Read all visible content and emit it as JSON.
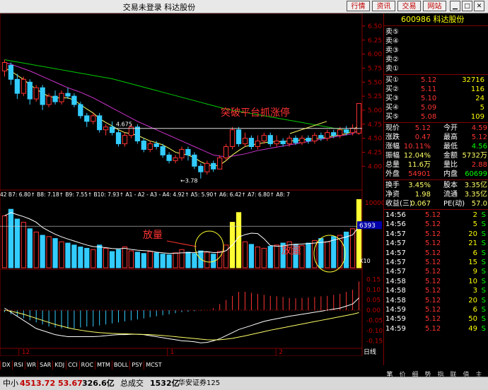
{
  "window": {
    "title": "交易未登录  科达股份"
  },
  "toolbar_buttons": [
    "行情",
    "资讯",
    "交易",
    "网站"
  ],
  "stock": {
    "code": "600986",
    "name": "科达股份"
  },
  "order_book": {
    "asks": [
      {
        "label": "卖⑤"
      },
      {
        "label": "卖④"
      },
      {
        "label": "卖③"
      },
      {
        "label": "卖②"
      },
      {
        "label": "卖①"
      }
    ],
    "bids": [
      {
        "label": "买①",
        "price": "5.12",
        "vol": "32716"
      },
      {
        "label": "买②",
        "price": "5.11",
        "vol": "116"
      },
      {
        "label": "买③",
        "price": "5.10",
        "vol": "24"
      },
      {
        "label": "买④",
        "price": "5.09",
        "vol": "5"
      },
      {
        "label": "买⑤",
        "price": "5.08",
        "vol": "109"
      }
    ]
  },
  "quote": [
    {
      "l1": "现价",
      "v1": "5.12",
      "l2": "今开",
      "v2": "4.59"
    },
    {
      "l1": "涨跌",
      "v1": "0.47",
      "l2": "最高",
      "v2": "5.12"
    },
    {
      "l1": "涨幅",
      "v1": "10.11%",
      "l2": "最低",
      "v2": "4.56"
    },
    {
      "l1": "振幅",
      "v1": "12.04%",
      "l2": "金额",
      "v2": "5732万"
    },
    {
      "l1": "总量",
      "v1": "11.6万",
      "l2": "量比",
      "v2": "2.88"
    },
    {
      "l1": "外盘",
      "v1": "54901",
      "l2": "内盘",
      "v2": "60699"
    },
    {
      "l1": "换手",
      "v1": "3.45%",
      "l2": "股本",
      "v2": "3.35亿"
    },
    {
      "l1": "净资",
      "v1": "1.98",
      "l2": "流通",
      "v2": "3.35亿"
    },
    {
      "l1": "收益(三)",
      "v1": "0.067",
      "l2": "PE(动)",
      "v2": "57.0"
    }
  ],
  "ticks": [
    {
      "t": "14:56",
      "p": "5.12",
      "v": "2",
      "s": "S"
    },
    {
      "t": "14:56",
      "p": "5.12",
      "v": "5",
      "s": "S"
    },
    {
      "t": "14:57",
      "p": "5.12",
      "v": "20",
      "s": "S"
    },
    {
      "t": "14:57",
      "p": "5.12",
      "v": "21",
      "s": "S"
    },
    {
      "t": "14:57",
      "p": "5.12",
      "v": "6",
      "s": "S"
    },
    {
      "t": "14:57",
      "p": "5.12",
      "v": "15",
      "s": "S"
    },
    {
      "t": "14:57",
      "p": "5.12",
      "v": "9",
      "s": "S"
    },
    {
      "t": "14:58",
      "p": "5.12",
      "v": "10",
      "s": "S"
    },
    {
      "t": "14:58",
      "p": "5.12",
      "v": "3",
      "s": "S"
    },
    {
      "t": "14:58",
      "p": "5.12",
      "v": "20",
      "s": "S"
    },
    {
      "t": "14:59",
      "p": "5.12",
      "v": "6",
      "s": "S"
    },
    {
      "t": "14:59",
      "p": "5.12",
      "v": "50",
      "s": "S"
    },
    {
      "t": "14:59",
      "p": "5.12",
      "v": "49",
      "s": "S"
    }
  ],
  "price_axis": [
    "6.50",
    "6.25",
    "6.00",
    "5.75",
    "5.50",
    "5.25",
    "5.00",
    "4.75",
    "4.50",
    "4.25",
    "4.00"
  ],
  "volume_axis": [
    "10000",
    "6393",
    "X10"
  ],
  "macd_axis": [
    "0.15",
    "0.10",
    "0.05",
    "0.00",
    "-0.05",
    "-0.10",
    "-0.15"
  ],
  "annotations": {
    "breakout": "突破平台抓涨停",
    "volume1": "放量",
    "volume2": "放量",
    "level_label": "4.675",
    "low_label": "3.78"
  },
  "ma_legend": "42  B7: 6.80↑  B8: 7.18↑  B9: 7.55↑  B10: 7.93↑  A1 - A2 - A3 - A4: 4.92↑  A5: 5.90↑  A6: 6.42↑  A7: 6.80↑  A8: 7",
  "date_axis": [
    "12",
    "1",
    "2"
  ],
  "period_label": "日线",
  "indicator_tabs": [
    "DX",
    "RSI",
    "WR",
    "SAR",
    "KDJ",
    "CCI",
    "ROC",
    "MTM",
    "BOLL",
    "PSY",
    "MCST"
  ],
  "right_tabs": [
    "笔",
    "价",
    "细",
    "势",
    "指",
    "联",
    "值",
    "主"
  ],
  "status": {
    "index_name": "中小",
    "index_value": "4513.72",
    "index_change": "53.67",
    "index_amount": "326.6亿",
    "total_label": "总成交",
    "total_value": "1532亿",
    "broker": "华安证券125"
  },
  "chart_data": {
    "type": "candlestick",
    "price_ylim": [
      3.6,
      6.6
    ],
    "candles": [
      {
        "o": 5.7,
        "c": 5.85,
        "h": 5.9,
        "l": 5.6
      },
      {
        "o": 5.8,
        "c": 5.55,
        "h": 5.85,
        "l": 5.45
      },
      {
        "o": 5.55,
        "c": 5.3,
        "h": 5.65,
        "l": 5.2
      },
      {
        "o": 5.3,
        "c": 5.55,
        "h": 5.6,
        "l": 5.25
      },
      {
        "o": 5.5,
        "c": 5.2,
        "h": 5.55,
        "l": 5.1
      },
      {
        "o": 5.2,
        "c": 5.4,
        "h": 5.45,
        "l": 5.15
      },
      {
        "o": 5.4,
        "c": 5.1,
        "h": 5.45,
        "l": 5.0
      },
      {
        "o": 5.1,
        "c": 5.25,
        "h": 5.3,
        "l": 5.05
      },
      {
        "o": 5.25,
        "c": 5.15,
        "h": 5.35,
        "l": 5.1
      },
      {
        "o": 5.15,
        "c": 5.3,
        "h": 5.35,
        "l": 5.1
      },
      {
        "o": 5.3,
        "c": 5.25,
        "h": 5.4,
        "l": 5.2
      },
      {
        "o": 5.25,
        "c": 5.1,
        "h": 5.3,
        "l": 5.05
      },
      {
        "o": 5.1,
        "c": 4.9,
        "h": 5.15,
        "l": 4.85
      },
      {
        "o": 4.9,
        "c": 4.8,
        "h": 4.95,
        "l": 4.7
      },
      {
        "o": 4.8,
        "c": 4.9,
        "h": 4.95,
        "l": 4.75
      },
      {
        "o": 4.9,
        "c": 4.65,
        "h": 4.95,
        "l": 4.6
      },
      {
        "o": 4.65,
        "c": 4.7,
        "h": 4.75,
        "l": 4.55
      },
      {
        "o": 4.7,
        "c": 4.6,
        "h": 4.8,
        "l": 4.55
      },
      {
        "o": 4.6,
        "c": 4.4,
        "h": 4.65,
        "l": 4.35
      },
      {
        "o": 4.4,
        "c": 4.55,
        "h": 4.6,
        "l": 4.35
      },
      {
        "o": 4.55,
        "c": 4.7,
        "h": 4.75,
        "l": 4.5
      },
      {
        "o": 4.7,
        "c": 4.45,
        "h": 4.75,
        "l": 4.4
      },
      {
        "o": 4.45,
        "c": 4.3,
        "h": 4.5,
        "l": 4.25
      },
      {
        "o": 4.3,
        "c": 4.4,
        "h": 4.45,
        "l": 4.25
      },
      {
        "o": 4.4,
        "c": 4.35,
        "h": 4.45,
        "l": 4.3
      },
      {
        "o": 4.35,
        "c": 4.2,
        "h": 4.4,
        "l": 4.15
      },
      {
        "o": 4.2,
        "c": 4.1,
        "h": 4.25,
        "l": 4.05
      },
      {
        "o": 4.1,
        "c": 4.15,
        "h": 4.2,
        "l": 4.05
      },
      {
        "o": 4.15,
        "c": 4.3,
        "h": 4.35,
        "l": 4.1
      },
      {
        "o": 4.3,
        "c": 4.2,
        "h": 4.35,
        "l": 4.1
      },
      {
        "o": 4.2,
        "c": 4.0,
        "h": 4.25,
        "l": 3.95
      },
      {
        "o": 4.0,
        "c": 3.9,
        "h": 4.05,
        "l": 3.78
      },
      {
        "o": 3.9,
        "c": 4.05,
        "h": 4.1,
        "l": 3.85
      },
      {
        "o": 4.05,
        "c": 3.95,
        "h": 4.1,
        "l": 3.9
      },
      {
        "o": 3.95,
        "c": 4.15,
        "h": 4.2,
        "l": 3.95
      },
      {
        "o": 4.15,
        "c": 4.35,
        "h": 4.4,
        "l": 4.1
      },
      {
        "o": 4.35,
        "c": 4.65,
        "h": 4.7,
        "l": 4.3
      },
      {
        "o": 4.65,
        "c": 4.4,
        "h": 4.7,
        "l": 4.35
      },
      {
        "o": 4.4,
        "c": 4.5,
        "h": 4.6,
        "l": 4.35
      },
      {
        "o": 4.5,
        "c": 4.35,
        "h": 4.55,
        "l": 4.3
      },
      {
        "o": 4.35,
        "c": 4.45,
        "h": 4.55,
        "l": 4.3
      },
      {
        "o": 4.45,
        "c": 4.55,
        "h": 4.6,
        "l": 4.4
      },
      {
        "o": 4.55,
        "c": 4.4,
        "h": 4.6,
        "l": 4.35
      },
      {
        "o": 4.4,
        "c": 4.45,
        "h": 4.55,
        "l": 4.35
      },
      {
        "o": 4.45,
        "c": 4.4,
        "h": 4.5,
        "l": 4.35
      },
      {
        "o": 4.4,
        "c": 4.5,
        "h": 4.55,
        "l": 4.35
      },
      {
        "o": 4.5,
        "c": 4.42,
        "h": 4.55,
        "l": 4.38
      },
      {
        "o": 4.42,
        "c": 4.5,
        "h": 4.55,
        "l": 4.38
      },
      {
        "o": 4.5,
        "c": 4.45,
        "h": 4.55,
        "l": 4.4
      },
      {
        "o": 4.45,
        "c": 4.55,
        "h": 4.6,
        "l": 4.4
      },
      {
        "o": 4.55,
        "c": 4.5,
        "h": 4.6,
        "l": 4.45
      },
      {
        "o": 4.5,
        "c": 4.6,
        "h": 4.65,
        "l": 4.45
      },
      {
        "o": 4.6,
        "c": 4.55,
        "h": 4.65,
        "l": 4.5
      },
      {
        "o": 4.55,
        "c": 4.65,
        "h": 4.7,
        "l": 4.5
      },
      {
        "o": 4.65,
        "c": 4.6,
        "h": 4.72,
        "l": 4.55
      },
      {
        "o": 4.6,
        "c": 4.68,
        "h": 4.75,
        "l": 4.55
      },
      {
        "o": 4.59,
        "c": 5.12,
        "h": 5.12,
        "l": 4.56
      }
    ],
    "ma_short": [
      5.75,
      5.7,
      5.62,
      5.55,
      5.45,
      5.38,
      5.3,
      5.25,
      5.22,
      5.22,
      5.22,
      5.18,
      5.1,
      5.02,
      4.95,
      4.85,
      4.78,
      4.72,
      4.65,
      4.6,
      4.58,
      4.55,
      4.5,
      4.45,
      4.42,
      4.38,
      4.32,
      4.25,
      4.22,
      4.2,
      4.15,
      4.08,
      4.03,
      4.0,
      4.02,
      4.1,
      4.2,
      4.28,
      4.35,
      4.38,
      4.4,
      4.42,
      4.43,
      4.44,
      4.44,
      4.45,
      4.46,
      4.47,
      4.48,
      4.49,
      4.5,
      4.52,
      4.54,
      4.56,
      4.58,
      4.62,
      4.75
    ],
    "ma_mid": [
      5.85,
      5.82,
      5.78,
      5.74,
      5.7,
      5.65,
      5.6,
      5.55,
      5.5,
      5.45,
      5.4,
      5.36,
      5.32,
      5.27,
      5.22,
      5.16,
      5.1,
      5.04,
      4.98,
      4.92,
      4.86,
      4.8,
      4.75,
      4.7,
      4.65,
      4.6,
      4.55,
      4.5,
      4.45,
      4.4,
      4.35,
      4.3,
      4.25,
      4.2,
      4.18,
      4.17,
      4.18,
      4.2,
      4.22,
      4.25,
      4.28,
      4.3,
      4.32,
      4.34,
      4.36,
      4.38,
      4.4,
      4.42,
      4.44,
      4.46,
      4.48,
      4.5,
      4.52,
      4.54,
      4.56,
      4.58,
      4.65
    ],
    "ma_long": [
      5.9,
      5.88,
      5.86,
      5.84,
      5.82,
      5.8,
      5.78,
      5.76,
      5.74,
      5.72,
      5.7,
      5.68,
      5.66,
      5.64,
      5.62,
      5.6,
      5.58,
      5.56,
      5.53,
      5.5,
      5.47,
      5.44,
      5.41,
      5.38,
      5.35,
      5.32,
      5.29,
      5.26,
      5.23,
      5.2,
      5.17,
      5.14,
      5.11,
      5.08,
      5.05,
      5.02,
      5.0,
      4.98,
      4.96,
      4.94,
      4.92,
      4.9,
      4.88,
      4.86,
      4.84,
      4.82,
      4.8,
      4.78,
      4.76,
      4.74,
      4.72,
      4.7,
      4.68,
      4.66,
      4.64,
      4.62,
      4.6
    ],
    "volume_ylim": [
      0,
      10000
    ],
    "volumes": [
      8000,
      9000,
      7500,
      7000,
      6000,
      5500,
      5000,
      4800,
      4500,
      4000,
      3800,
      3500,
      3200,
      3000,
      2800,
      3500,
      3000,
      2500,
      2800,
      3200,
      2600,
      2400,
      2200,
      2500,
      2300,
      2100,
      2000,
      2300,
      2800,
      2400,
      2200,
      2600,
      2400,
      2100,
      2500,
      3500,
      7000,
      8500,
      4000,
      3600,
      3200,
      3000,
      3300,
      3500,
      3800,
      4000,
      3600,
      3400,
      3800,
      4200,
      4500,
      4000,
      4800,
      5000,
      5500,
      6000,
      10500
    ],
    "macd_ylim": [
      -0.18,
      0.18
    ],
    "macd_hist": [
      -0.01,
      -0.02,
      -0.03,
      -0.04,
      -0.05,
      -0.06,
      -0.07,
      -0.08,
      -0.085,
      -0.09,
      -0.09,
      -0.09,
      -0.085,
      -0.08,
      -0.08,
      -0.075,
      -0.07,
      -0.065,
      -0.06,
      -0.055,
      -0.05,
      -0.045,
      -0.04,
      -0.035,
      -0.03,
      -0.025,
      -0.02,
      -0.015,
      -0.01,
      -0.008,
      -0.005,
      -0.002,
      0.0,
      0.01,
      0.03,
      0.05,
      0.07,
      0.09,
      0.09,
      0.085,
      0.08,
      0.075,
      0.07,
      0.068,
      0.065,
      0.06,
      0.058,
      0.06,
      0.062,
      0.065,
      0.068,
      0.07,
      0.075,
      0.08,
      0.09,
      0.1,
      0.14
    ],
    "macd_dif": [
      0.01,
      -0.01,
      -0.03,
      -0.05,
      -0.07,
      -0.09,
      -0.1,
      -0.11,
      -0.12,
      -0.125,
      -0.13,
      -0.13,
      -0.13,
      -0.13,
      -0.13,
      -0.128,
      -0.125,
      -0.122,
      -0.12,
      -0.12,
      -0.118,
      -0.118,
      -0.12,
      -0.125,
      -0.13,
      -0.135,
      -0.14,
      -0.145,
      -0.15,
      -0.152,
      -0.155,
      -0.16,
      -0.158,
      -0.15,
      -0.14,
      -0.125,
      -0.11,
      -0.095,
      -0.085,
      -0.075,
      -0.065,
      -0.055,
      -0.048,
      -0.042,
      -0.036,
      -0.03,
      -0.025,
      -0.02,
      -0.015,
      -0.01,
      -0.005,
      0.0,
      0.005,
      0.01,
      0.02,
      0.03,
      0.06
    ],
    "macd_dea": [
      0.0,
      -0.005,
      -0.012,
      -0.02,
      -0.03,
      -0.04,
      -0.05,
      -0.06,
      -0.07,
      -0.078,
      -0.086,
      -0.093,
      -0.098,
      -0.103,
      -0.107,
      -0.11,
      -0.112,
      -0.114,
      -0.115,
      -0.116,
      -0.117,
      -0.118,
      -0.119,
      -0.12,
      -0.122,
      -0.124,
      -0.127,
      -0.13,
      -0.133,
      -0.136,
      -0.139,
      -0.142,
      -0.145,
      -0.146,
      -0.145,
      -0.142,
      -0.138,
      -0.132,
      -0.126,
      -0.119,
      -0.112,
      -0.105,
      -0.098,
      -0.092,
      -0.086,
      -0.08,
      -0.074,
      -0.068,
      -0.062,
      -0.056,
      -0.05,
      -0.044,
      -0.038,
      -0.032,
      -0.026,
      -0.02,
      -0.012
    ]
  }
}
